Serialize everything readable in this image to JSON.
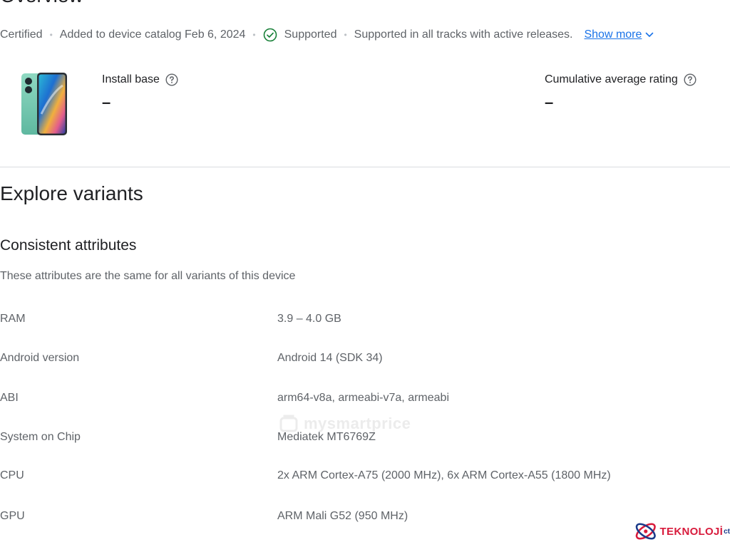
{
  "overview": {
    "title": "Overview"
  },
  "meta": {
    "certified": "Certified",
    "added": "Added to device catalog Feb 6, 2024",
    "supported": "Supported",
    "supported_detail": "Supported in all tracks with active releases.",
    "show_more": "Show more"
  },
  "stats": {
    "install_base": {
      "label": "Install base",
      "value": "–"
    },
    "rating": {
      "label": "Cumulative average rating",
      "value": "–"
    }
  },
  "explore": {
    "title": "Explore variants",
    "consistent_title": "Consistent attributes",
    "consistent_desc": "These attributes are the same for all variants of this device"
  },
  "attributes": [
    {
      "name": "RAM",
      "value": "3.9 – 4.0 GB"
    },
    {
      "name": "Android version",
      "value": "Android 14 (SDK 34)"
    },
    {
      "name": "ABI",
      "value": "arm64-v8a, armeabi-v7a, armeabi"
    },
    {
      "name": "System on Chip",
      "value": "Mediatek MT6769Z"
    },
    {
      "name": "CPU",
      "value": "2x ARM Cortex-A75 (2000 MHz), 6x ARM Cortex-A55 (1800 MHz)"
    },
    {
      "name": "GPU",
      "value": "ARM Mali G52 (950 MHz)"
    }
  ],
  "watermark": {
    "text": "mysmartprice"
  },
  "brand": {
    "name": "TEKNOLOJİ",
    "suffix": "ct"
  },
  "colors": {
    "link": "#1a73e8",
    "supported_check": "#188038",
    "text_primary": "#202124",
    "text_secondary": "#5f6368",
    "brand_red": "#d81b3c",
    "brand_blue": "#1a3a8a"
  },
  "icons": {
    "check": "check-circle-icon",
    "help": "help-circle-icon",
    "chevron": "chevron-down-icon",
    "device": "phone-device-image"
  }
}
